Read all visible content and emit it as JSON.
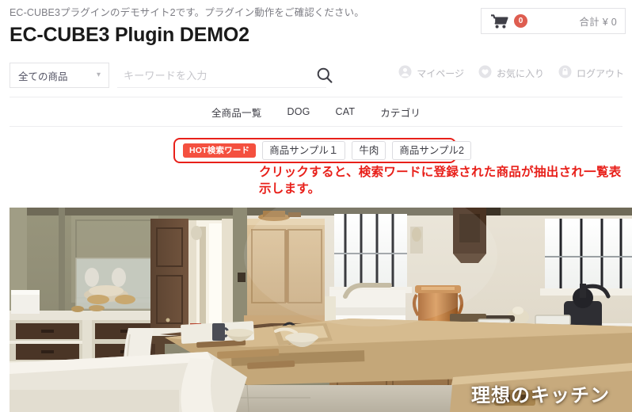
{
  "header": {
    "note": "EC-CUBE3プラグインのデモサイト2です。プラグイン動作をご確認ください。",
    "title": "EC-CUBE3 Plugin DEMO2",
    "cart": {
      "icon": "shopping-cart-icon",
      "badge_count": "0",
      "total_label": "合計 ¥ 0"
    }
  },
  "search": {
    "category_value": "全ての商品",
    "category_chevron": "chevron-down-icon",
    "placeholder": "キーワードを入力",
    "input_value": "",
    "submit_icon": "search-icon"
  },
  "account": {
    "links": [
      {
        "label": "マイページ",
        "icon": "person-icon"
      },
      {
        "label": "お気に入り",
        "icon": "heart-icon"
      },
      {
        "label": "ログアウト",
        "icon": "lock-icon"
      }
    ]
  },
  "nav": {
    "items": [
      {
        "label": "全商品一覧"
      },
      {
        "label": "DOG"
      },
      {
        "label": "CAT"
      },
      {
        "label": "カテゴリ"
      }
    ]
  },
  "hot_search": {
    "badge_label": "HOT検索ワード",
    "words": [
      {
        "label": "商品サンプル１"
      },
      {
        "label": "牛肉"
      },
      {
        "label": "商品サンプル2"
      }
    ],
    "annotation": "クリックすると、検索ワードに登録された商品が抽出され一覧表示します。",
    "highlight_color": "#e8201a",
    "badge_color": "#f4503f"
  },
  "hero": {
    "caption": "理想のキッチン",
    "alt": "vintage-kitchen-interior-photo"
  }
}
